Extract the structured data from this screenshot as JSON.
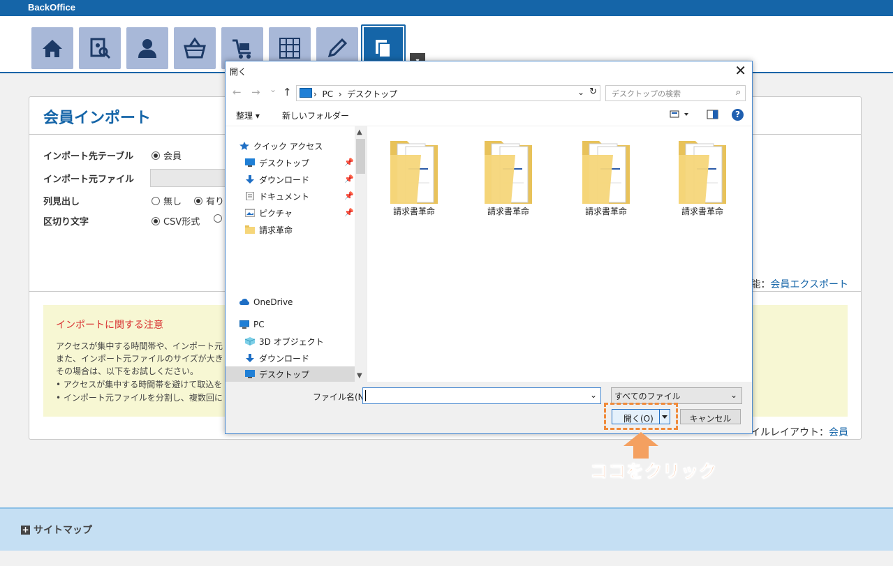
{
  "app": {
    "brand": "BackOffice"
  },
  "nav": {
    "icons": [
      "home-icon",
      "member-search-icon",
      "user-icon",
      "basket-icon",
      "cart-icon",
      "grid-icon",
      "pencil-icon",
      "documents-icon"
    ],
    "more_label": "▾"
  },
  "page": {
    "title": "会員インポート",
    "rows": [
      {
        "label": "インポート先テーブル",
        "options": [
          "会員"
        ]
      },
      {
        "label": "インポート元ファイル"
      },
      {
        "label": "列見出し",
        "options": [
          "無し",
          "有り"
        ]
      },
      {
        "label": "区切り文字",
        "options": [
          "CSV形式"
        ]
      }
    ],
    "export_prefix": "能：",
    "export_link": "会員エクスポート",
    "notice_title": "インポートに関する注意",
    "notice_lines": [
      "アクセスが集中する時間帯や、インポート元",
      "また、インポート元ファイルのサイズが大き",
      "その場合は、以下をお試しください。",
      "•  アクセスが集中する時間帯を避けて取込を",
      "•  インポート元ファイルを分割し、複数回に"
    ],
    "layout_prefix": "イルレイアウト：",
    "layout_link": "会員"
  },
  "footer": {
    "sitemap": "サイトマップ",
    "plus": "+"
  },
  "dialog": {
    "title": "開く",
    "close": "✕",
    "back": "←",
    "forward": "→",
    "recent": "⌄",
    "up": "↑",
    "path_pc": "PC",
    "path_sep": "›",
    "path_folder": "デスクトップ",
    "search_placeholder": "デスクトップの検索",
    "organize": "整理 ▾",
    "new_folder": "新しいフォルダー",
    "help": "?",
    "nav_items": [
      {
        "label": "クイック アクセス",
        "icon": "star-icon"
      },
      {
        "label": "デスクトップ",
        "icon": "desktop-icon"
      },
      {
        "label": "ダウンロード",
        "icon": "download-icon"
      },
      {
        "label": "ドキュメント",
        "icon": "document-icon"
      },
      {
        "label": "ピクチャ",
        "icon": "picture-icon"
      },
      {
        "label": "請求革命",
        "icon": "folder-icon"
      },
      {
        "label": "OneDrive",
        "icon": "cloud-icon"
      },
      {
        "label": "PC",
        "icon": "pc-icon"
      },
      {
        "label": "3D オブジェクト",
        "icon": "cube-icon"
      },
      {
        "label": "ダウンロード",
        "icon": "download-icon"
      },
      {
        "label": "デスクトップ",
        "icon": "desktop-icon"
      }
    ],
    "pin": "📌",
    "files": [
      "請求書革命",
      "請求書革命",
      "請求書革命",
      "請求書革命"
    ],
    "filename_label": "ファイル名(N):",
    "filename_value": "",
    "filetype": "すべてのファイル",
    "open_label": "開く(O)",
    "cancel_label": "キャンセル",
    "chev": "⌄"
  },
  "annotation": {
    "text": "ココをクリック"
  },
  "colors": {
    "brand": "#1565a8",
    "accent": "#f07b2a",
    "notice_bg": "#f7f7d3"
  }
}
